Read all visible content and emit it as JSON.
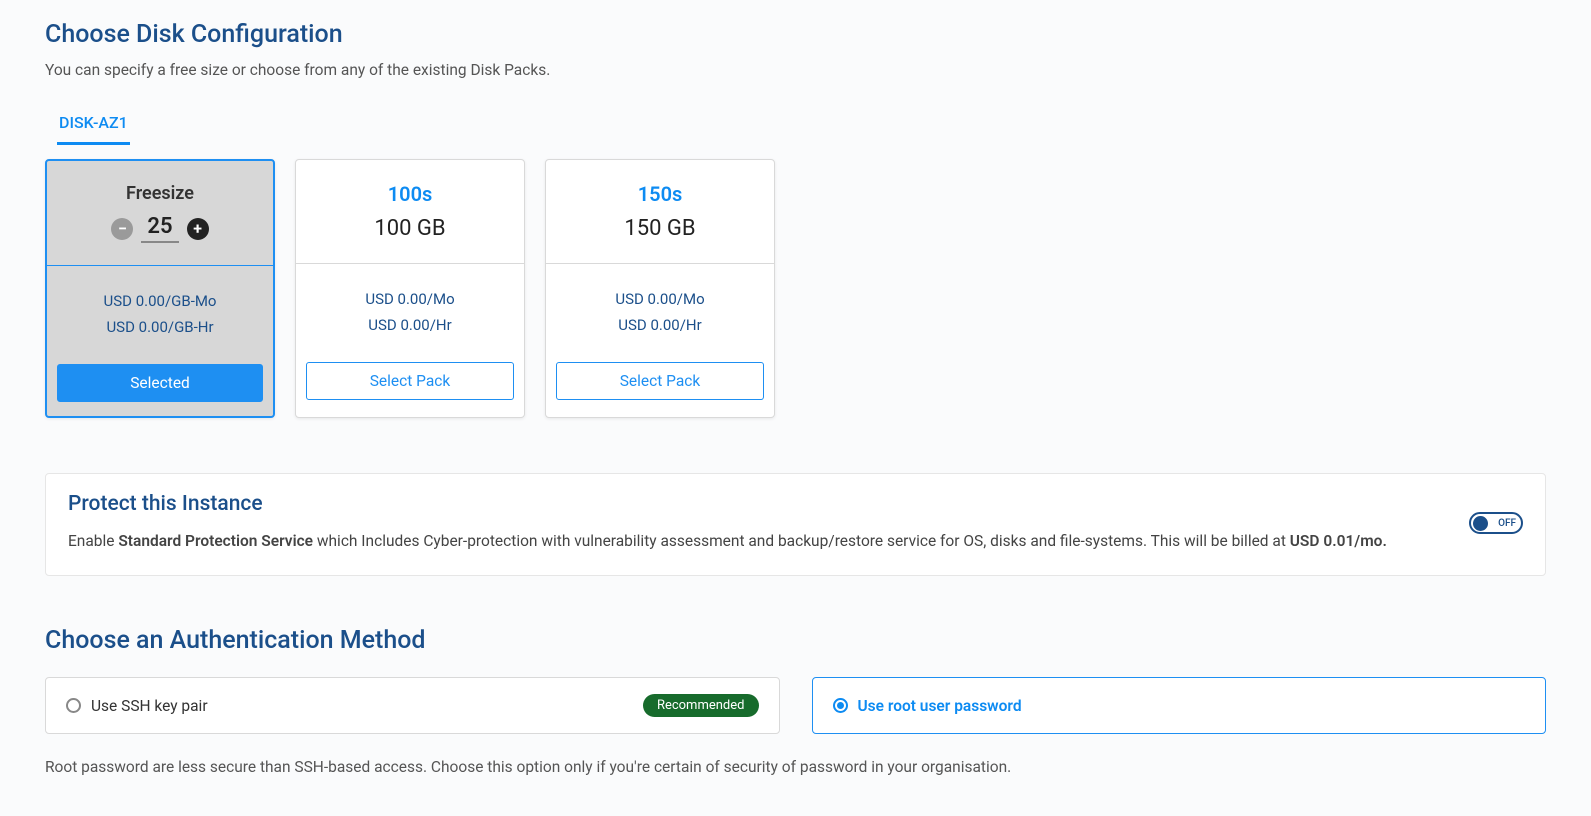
{
  "disk": {
    "title": "Choose Disk Configuration",
    "subtitle": "You can specify a free size or choose from any of the existing Disk Packs.",
    "tab": "DISK-AZ1",
    "freesize": {
      "label": "Freesize",
      "value": "25",
      "price_mo": "USD 0.00/GB-Mo",
      "price_hr": "USD 0.00/GB-Hr",
      "button": "Selected"
    },
    "packs": [
      {
        "name": "100s",
        "size": "100 GB",
        "price_mo": "USD 0.00/Mo",
        "price_hr": "USD 0.00/Hr",
        "button": "Select Pack"
      },
      {
        "name": "150s",
        "size": "150 GB",
        "price_mo": "USD 0.00/Mo",
        "price_hr": "USD 0.00/Hr",
        "button": "Select Pack"
      }
    ]
  },
  "protect": {
    "title": "Protect this Instance",
    "desc_prefix": "Enable ",
    "desc_bold1": "Standard Protection Service",
    "desc_mid": " which Includes Cyber-protection with vulnerability assessment and backup/restore service for OS, disks and file-systems. This will be billed at ",
    "desc_bold2": "USD 0.01/mo.",
    "toggle_label": "OFF"
  },
  "auth": {
    "title": "Choose an Authentication Method",
    "option_ssh": "Use SSH key pair",
    "badge": "Recommended",
    "option_root": "Use root user password",
    "note": "Root password are less secure than SSH-based access. Choose this option only if you're certain of security of password in your organisation."
  }
}
